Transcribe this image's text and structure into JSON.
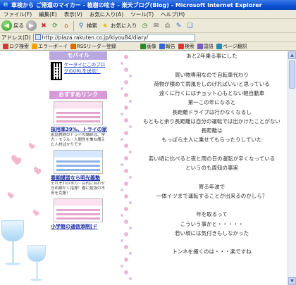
{
  "window": {
    "title": "車検から ご帰還のマイカー - 植樹の呟き - 楽天ブログ(Blog) - Microsoft Internet Explorer"
  },
  "menu": [
    "ファイル(F)",
    "編集(E)",
    "表示(V)",
    "お気に入り(A)",
    "ツール(T)",
    "ヘルプ(H)"
  ],
  "toolbar": {
    "back_label": "戻る",
    "search_label": "検索",
    "favorites_label": "お気に入り"
  },
  "address": {
    "label": "アドレス(D)",
    "url": "http://plaza.rakuten.co.jp/kiyou84/diary/"
  },
  "linkbar": {
    "search_label": "ログ検索",
    "bookmark_label": "エラーボーイ",
    "update_label": "RSSリーダー登録",
    "tab1": "画像",
    "tab2": "報告",
    "tab3": "検索",
    "tab4": "国語",
    "tab5": "ページ翻訳"
  },
  "sidebar": {
    "mobile_header": "モバイル",
    "mobile_link": "ケータイにこのブログのURLを送信！",
    "recommend_header": "おすすめリンク",
    "items": [
      {
        "title": "採用率39%、トライの家庭教師",
        "desc": "家庭教師のトライの講師は、学力・モラル・人間性を兼ね備えた人材ばかりです"
      },
      {
        "title": "春期講習なら明光義塾",
        "desc": "それぞれの学力・目的に合わせきめ細かく指導！春に勉強の不安を克服！"
      },
      {
        "title": "小学館の通信添削[ド"
      }
    ]
  },
  "main": {
    "lines": [
      "あと2年乗る事にした",
      "",
      "買い物専用なので自転車代わり",
      "荷物が積めて雨風をしのげればいいと思っている",
      "遠くに行くにはチョット心もとない軽自動車",
      "第一この年になると",
      "長距離ドライブは行かなくなるし",
      "もともと余り長距離は自分の運転では出かけたことがない",
      "長距離は",
      "もっぱら主人に乗せてもらったりしていた",
      "",
      "若い頃に比べると夜と雨の日の運転が辛くなっている",
      "というのも周知の事実",
      "",
      "寄る年波で",
      "一体イツまで運転することが出来るのかしら？",
      "",
      "年を取るって",
      "こういう事かと・・・・・",
      "若い頃には気付きもしなかった",
      "",
      "トンネを掻くのは・・・楽ですね"
    ]
  }
}
